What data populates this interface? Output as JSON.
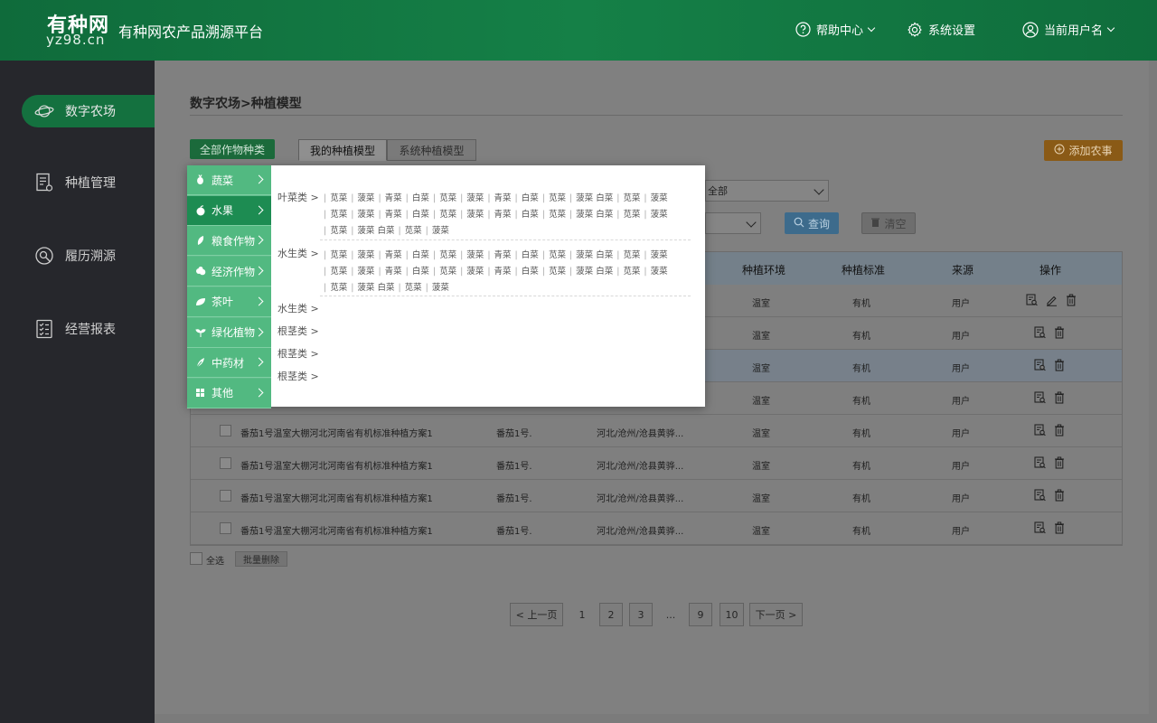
{
  "header": {
    "logo_big": "有种网",
    "logo_small": "yz98.cn",
    "platform_title": "有种网农产品溯源平台",
    "help_label": "帮助中心",
    "settings_label": "系统设置",
    "user_label": "当前用户名"
  },
  "sidebar": {
    "items": [
      {
        "label": "数字农场",
        "icon": "planet-icon"
      },
      {
        "label": "种植管理",
        "icon": "document-gear-icon"
      },
      {
        "label": "履历溯源",
        "icon": "trace-icon"
      },
      {
        "label": "经营报表",
        "icon": "checklist-icon"
      }
    ]
  },
  "main": {
    "breadcrumb": "数字农场>种植模型",
    "all_crops_button": "全部作物种类",
    "tabs": [
      {
        "label": "我的种植模型"
      },
      {
        "label": "系统种植模型"
      }
    ],
    "add_button": "添加农事",
    "filter_select_value": "全部",
    "query_button": "查询",
    "clear_button": "清空",
    "table": {
      "headers": [
        "种植环境",
        "种植标准",
        "来源",
        "操作"
      ],
      "rows": [
        {
          "name": "",
          "plan": "",
          "region": "",
          "env": "温室",
          "std": "有机",
          "src": "用户"
        },
        {
          "name": "",
          "plan": "",
          "region": "",
          "env": "温室",
          "std": "有机",
          "src": "用户"
        },
        {
          "name": "",
          "plan": "",
          "region": "",
          "env": "温室",
          "std": "有机",
          "src": "用户"
        },
        {
          "name": "",
          "plan": "",
          "region": "",
          "env": "温室",
          "std": "有机",
          "src": "用户"
        },
        {
          "name": "番茄1号温室大棚河北河南省有机标准种植方案1",
          "plan": "番茄1号.",
          "region": "河北/沧州/沧县黄骅...",
          "env": "温室",
          "std": "有机",
          "src": "用户"
        },
        {
          "name": "番茄1号温室大棚河北河南省有机标准种植方案1",
          "plan": "番茄1号.",
          "region": "河北/沧州/沧县黄骅...",
          "env": "温室",
          "std": "有机",
          "src": "用户"
        },
        {
          "name": "番茄1号温室大棚河北河南省有机标准种植方案1",
          "plan": "番茄1号.",
          "region": "河北/沧州/沧县黄骅...",
          "env": "温室",
          "std": "有机",
          "src": "用户"
        },
        {
          "name": "番茄1号温室大棚河北河南省有机标准种植方案1",
          "plan": "番茄1号.",
          "region": "河北/沧州/沧县黄骅...",
          "env": "温室",
          "std": "有机",
          "src": "用户"
        }
      ]
    },
    "select_all": "全选",
    "batch_delete": "批量删除",
    "pagination": {
      "prev": "< 上一页",
      "pages": [
        "1",
        "2",
        "3",
        "...",
        "9",
        "10"
      ],
      "next": "下一页 >"
    }
  },
  "dropdown": {
    "categories": [
      {
        "label": "蔬菜",
        "icon": "vegetable-icon"
      },
      {
        "label": "水果",
        "icon": "fruit-icon"
      },
      {
        "label": "粮食作物",
        "icon": "grain-icon"
      },
      {
        "label": "经济作物",
        "icon": "cash-crop-icon"
      },
      {
        "label": "茶叶",
        "icon": "tea-icon"
      },
      {
        "label": "绿化植物",
        "icon": "greening-icon"
      },
      {
        "label": "中药材",
        "icon": "herb-icon"
      },
      {
        "label": "其他",
        "icon": "grid-icon"
      }
    ],
    "groups": [
      {
        "label": "叶菜类 >"
      },
      {
        "label": "水生类 >"
      },
      {
        "label": "水生类 >"
      },
      {
        "label": "根茎类 >"
      },
      {
        "label": "根茎类 >"
      },
      {
        "label": "根茎类 >"
      }
    ],
    "veg_line_full": [
      "苋菜",
      "菠菜",
      "青菜",
      "白菜",
      "苋菜",
      "菠菜",
      "青菜",
      "白菜",
      "苋菜",
      "菠菜 白菜",
      "苋菜",
      "菠菜"
    ],
    "veg_line_short": [
      "苋菜",
      "菠菜 白菜",
      "苋菜",
      "菠菜"
    ]
  },
  "colors": {
    "header_green": "#158047",
    "menu_green": "#52b981",
    "menu_active": "#1d8c52",
    "add_orange": "#f0922a"
  }
}
